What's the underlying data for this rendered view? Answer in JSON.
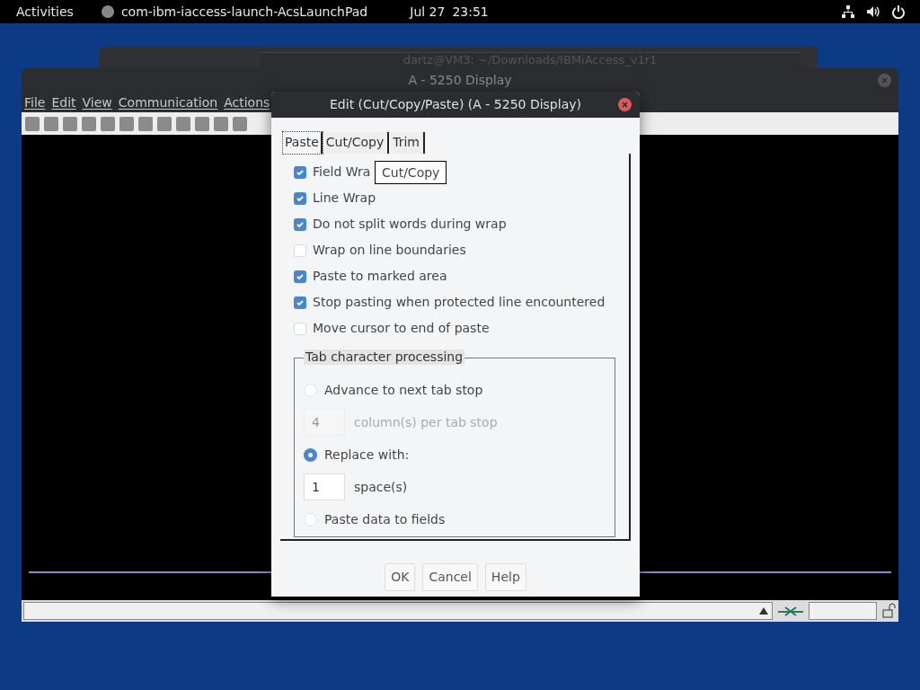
{
  "top_bar": {
    "activities": "Activities",
    "app": "com-ibm-iaccess-launch-AcsLaunchPad",
    "date": "Jul 27",
    "time": "23:51"
  },
  "back_window": {
    "title": "dartz@VM3: ~/Downloads/IBMiAccess_v1r1"
  },
  "main_window": {
    "title": "A - 5250 Display",
    "menu": [
      "File",
      "Edit",
      "View",
      "Communication",
      "Actions"
    ]
  },
  "dialog": {
    "title": "Edit (Cut/Copy/Paste) (A - 5250 Display)",
    "tabs": [
      {
        "label": "Paste",
        "selected": true
      },
      {
        "label": "Cut/Copy",
        "selected": false
      },
      {
        "label": "Trim",
        "selected": false
      }
    ],
    "tooltip": "Cut/Copy",
    "options": [
      {
        "label": "Field Wra",
        "checked": true
      },
      {
        "label": "Line Wrap",
        "checked": true
      },
      {
        "label": "Do not split words during wrap",
        "checked": true
      },
      {
        "label": "Wrap on line boundaries",
        "checked": false
      },
      {
        "label": "Paste to marked area",
        "checked": true
      },
      {
        "label": "Stop pasting when protected line encountered",
        "checked": true
      },
      {
        "label": "Move cursor to end of paste",
        "checked": false
      }
    ],
    "group": {
      "title": "Tab character processing",
      "items": [
        {
          "kind": "radio",
          "label": "Advance to next tab stop",
          "selected": false
        },
        {
          "kind": "field",
          "value": "4",
          "label": "column(s) per tab stop",
          "disabled": true
        },
        {
          "kind": "radio",
          "label": "Replace with:",
          "selected": true
        },
        {
          "kind": "field",
          "value": "1",
          "label": "space(s)",
          "disabled": false
        },
        {
          "kind": "radio",
          "label": "Paste data to fields",
          "selected": false
        }
      ]
    },
    "buttons": [
      "OK",
      "Cancel",
      "Help"
    ]
  }
}
